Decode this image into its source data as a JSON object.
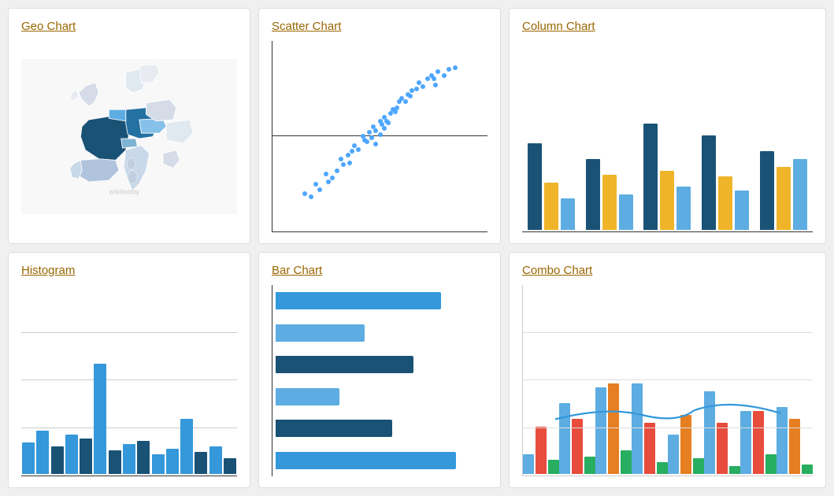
{
  "cards": [
    {
      "id": "geo-chart",
      "title": "Geo Chart"
    },
    {
      "id": "scatter-chart",
      "title": "Scatter Chart"
    },
    {
      "id": "column-chart",
      "title": "Column Chart"
    },
    {
      "id": "histogram",
      "title": "Histogram"
    },
    {
      "id": "bar-chart",
      "title": "Bar Chart"
    },
    {
      "id": "combo-chart",
      "title": "Combo Chart"
    }
  ],
  "colors": {
    "blue_dark": "#1a5276",
    "blue_mid": "#2980b9",
    "blue_light": "#5dade2",
    "blue_bright": "#3498db",
    "yellow": "#f0b429",
    "orange": "#e67e22",
    "red": "#e74c3c",
    "green": "#27ae60",
    "scatter_dot": "#4da6ff"
  }
}
